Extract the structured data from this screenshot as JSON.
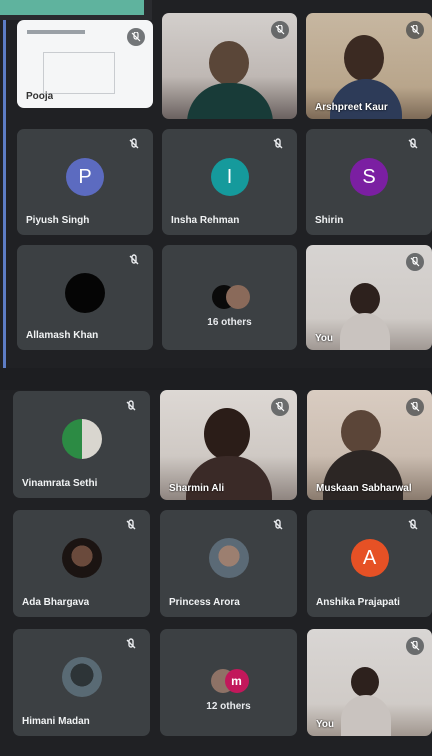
{
  "meeting": {
    "section1": {
      "presentation": {
        "label": "Pooja"
      },
      "tiles": [
        {
          "name": "Arshpreet Kaur",
          "type": "video"
        },
        {
          "name": "Piyush Singh",
          "initial": "P",
          "color": "#5c6bc0",
          "type": "initial"
        },
        {
          "name": "Insha Rehman",
          "initial": "I",
          "color": "#159a9c",
          "type": "initial"
        },
        {
          "name": "Shirin",
          "initial": "S",
          "color": "#7b1fa2",
          "type": "initial"
        },
        {
          "name": "Allamash Khan",
          "type": "photo"
        },
        {
          "name": "16 others",
          "type": "group"
        },
        {
          "name": "You",
          "type": "video"
        }
      ]
    },
    "section2": {
      "tiles": [
        {
          "name": "Vinamrata Sethi",
          "type": "photo"
        },
        {
          "name": "Sharmin Ali",
          "type": "video"
        },
        {
          "name": "Muskaan Sabharwal",
          "type": "video"
        },
        {
          "name": "Ada Bhargava",
          "type": "photo"
        },
        {
          "name": "Princess Arora",
          "type": "photo"
        },
        {
          "name": "Anshika Prajapati",
          "initial": "A",
          "color": "#e65125",
          "type": "initial"
        },
        {
          "name": "Himani Madan",
          "type": "photo"
        },
        {
          "name": "12 others",
          "type": "group"
        },
        {
          "name": "You",
          "type": "video"
        }
      ]
    }
  },
  "icons": {
    "muted": "mic-off-icon",
    "group_more": "m"
  }
}
